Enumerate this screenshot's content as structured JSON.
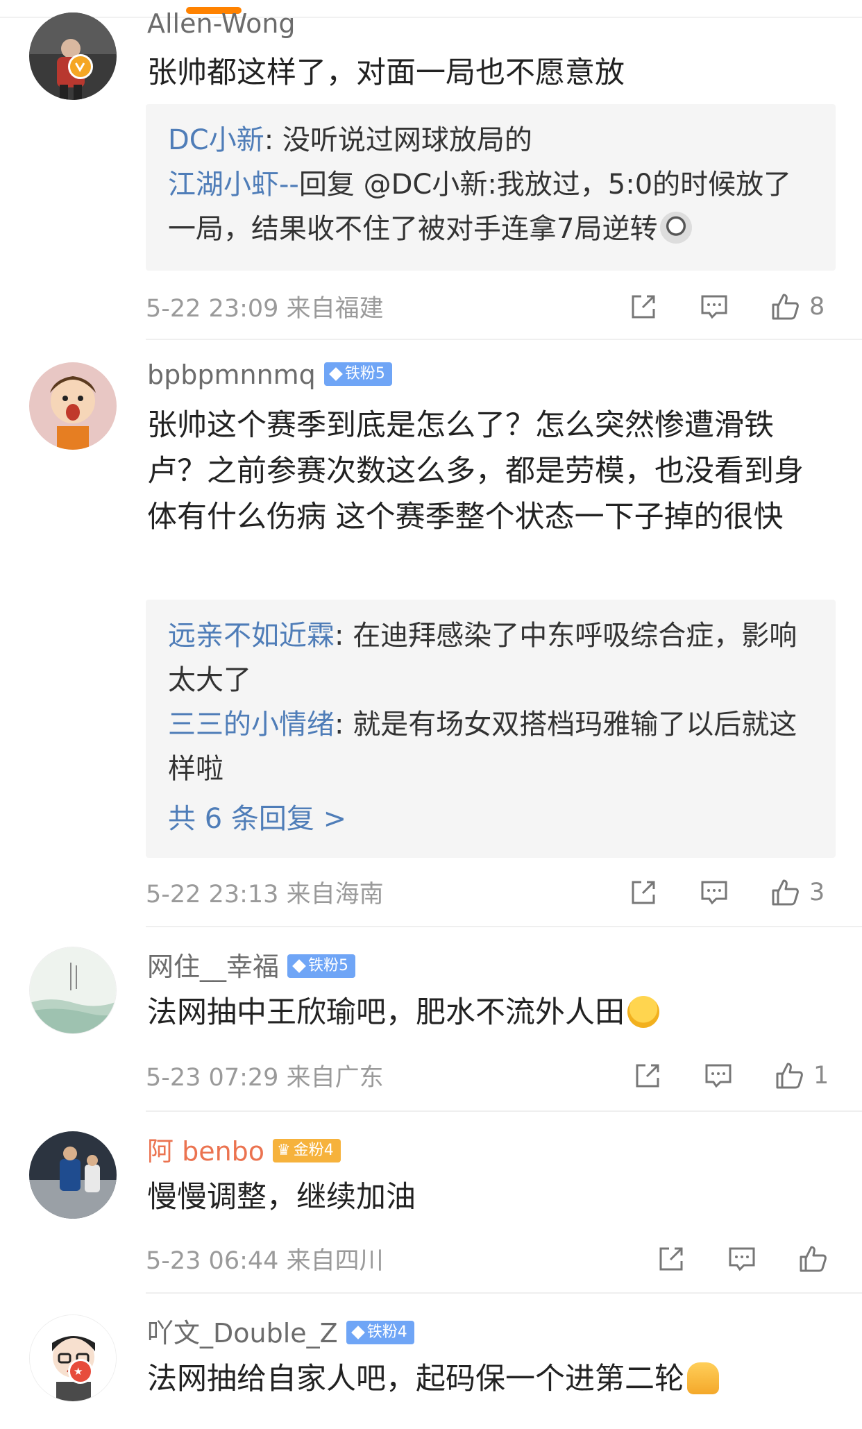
{
  "comments": [
    {
      "username": "Allen-Wong",
      "text": "张帅都这样了，对面一局也不愿意放",
      "replies": [
        {
          "user": "DC小新",
          "text": ": 没听说过网球放局的"
        },
        {
          "user": "江湖小虾--",
          "text": "回复 @DC小新:我放过，5:0的时候放了一局，结果收不住了被对手连拿7局逆转"
        }
      ],
      "time": "5-22 23:09",
      "location": "来自福建",
      "likes": "8"
    },
    {
      "username": "bpbpmnnmq",
      "fan_badge": "铁粉5",
      "text": "张帅这个赛季到底是怎么了？怎么突然惨遭滑铁卢？之前参赛次数这么多，都是劳模，也没看到身体有什么伤病 这个赛季整个状态一下子掉的很快",
      "replies": [
        {
          "user": "远亲不如近霖",
          "text": ": 在迪拜感染了中东呼吸综合症，影响太大了"
        },
        {
          "user": "三三的小情绪",
          "text": ": 就是有场女双搭档玛雅输了以后就这样啦"
        }
      ],
      "more_replies": "共 6 条回复 >",
      "time": "5-22 23:13",
      "location": "来自海南",
      "likes": "3"
    },
    {
      "username": "网住__幸福",
      "fan_badge": "铁粉5",
      "text": "法网抽中王欣瑜吧，肥水不流外人田",
      "time": "5-23 07:29",
      "location": "来自广东",
      "likes": "1"
    },
    {
      "username": "阿 benbo",
      "fan_badge": "金粉4",
      "text": "慢慢调整，继续加油",
      "time": "5-23 06:44",
      "location": "来自四川",
      "likes": ""
    },
    {
      "username": "吖文_Double_Z",
      "fan_badge": "铁粉4",
      "text": "法网抽给自家人吧，起码保一个进第二轮"
    }
  ],
  "colors": {
    "username": "#6c6c6c",
    "reply_user": "#4f7db8",
    "gold_name": "#eb7350",
    "fan_badge_blue": "#6fa5f6",
    "fan_badge_gold": "#f6b23c"
  }
}
